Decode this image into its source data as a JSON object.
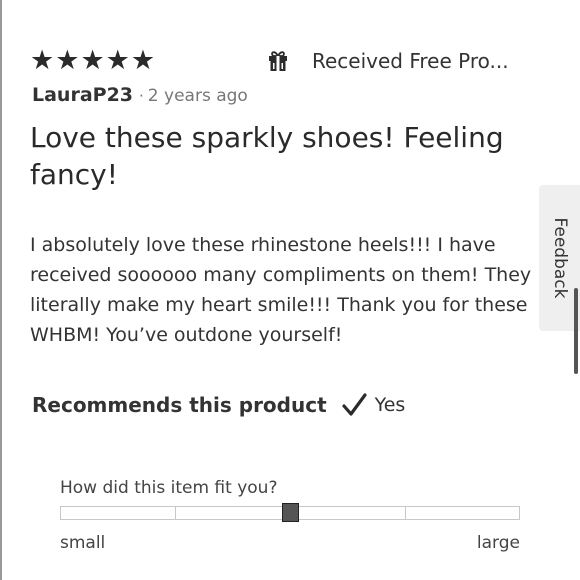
{
  "review": {
    "rating": 5,
    "stars": [
      "★",
      "★",
      "★",
      "★",
      "★"
    ],
    "free_product_label": "Received Free Pro...",
    "author": "LauraP23",
    "separator": "·",
    "time_ago": "2 years ago",
    "title": "Love these sparkly shoes! Feeling fancy!",
    "body": "I absolutely love these rhinestone heels!!! I have received soooooo many compliments on them! They literally make my heart smile!!! Thank you for these WHBM! You’ve outdone yourself!",
    "recommends_label": "Recommends this product",
    "recommends_value": "Yes"
  },
  "fit": {
    "question": "How did this item fit you?",
    "min_label": "small",
    "max_label": "large",
    "segments": 4,
    "value": 0.5
  },
  "feedback_tab": {
    "label": "Feedback"
  },
  "icons": {
    "gift": "gift-icon",
    "check": "checkmark-icon"
  },
  "colors": {
    "text": "#333333",
    "muted": "#777777",
    "knob": "#555555",
    "tab_bg": "#efefef"
  }
}
